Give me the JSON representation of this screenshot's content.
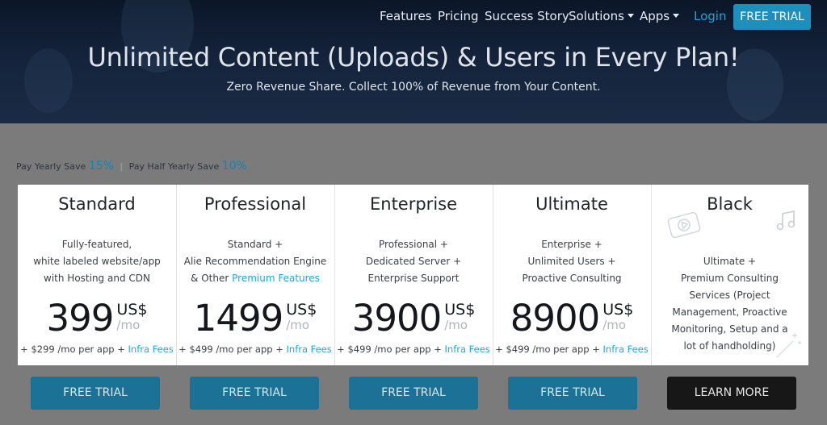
{
  "nav": {
    "items": [
      "Features",
      "Pricing",
      "Success Story",
      "Solutions",
      "Apps"
    ],
    "login": "Login",
    "free_trial": "FREE TRIAL"
  },
  "hero": {
    "title": "Unlimited Content (Uploads) & Users in Every Plan!",
    "subtitle": "Zero Revenue Share. Collect 100% of Revenue from Your Content."
  },
  "billing": {
    "yearly_label": "Pay Yearly Save",
    "yearly_pct": "15%",
    "half_label": "Pay Half Yearly Save",
    "half_pct": "10%"
  },
  "plans": [
    {
      "name": "Standard",
      "desc": [
        "Fully-featured,",
        "white labeled website/app",
        "with Hosting and CDN"
      ],
      "price": "399",
      "currency": "US$",
      "period": "/mo",
      "fee_text": "+ $299 /mo per app + ",
      "fee_link": "Infra Fees",
      "button": "FREE TRIAL"
    },
    {
      "name": "Professional",
      "desc": [
        "Standard +",
        "Alie Recommendation Engine",
        "& Other "
      ],
      "desc_link": "Premium Features",
      "price": "1499",
      "currency": "US$",
      "period": "/mo",
      "fee_text": "+ $499 /mo per app + ",
      "fee_link": "Infra Fees",
      "button": "FREE TRIAL"
    },
    {
      "name": "Enterprise",
      "desc": [
        "Professional +",
        "Dedicated Server +",
        "Enterprise Support"
      ],
      "price": "3900",
      "currency": "US$",
      "period": "/mo",
      "fee_text": "+ $499 /mo per app + ",
      "fee_link": "Infra Fees",
      "button": "FREE TRIAL"
    },
    {
      "name": "Ultimate",
      "desc": [
        "Enterprise +",
        "Unlimited Users +",
        "Proactive Consulting"
      ],
      "price": "8900",
      "currency": "US$",
      "period": "/mo",
      "fee_text": "+ $499 /mo per app + ",
      "fee_link": "Infra Fees",
      "button": "FREE TRIAL"
    },
    {
      "name": "Black",
      "desc": [
        "Ultimate +",
        "Premium Consulting",
        "Services (Project",
        "Management, Proactive",
        "Monitoring, Setup and a",
        "lot of handholding)"
      ],
      "button": "LEARN MORE"
    }
  ],
  "colors": {
    "accent": "#19a8e0",
    "primary_button": "#1b7296",
    "dark_button": "#171717",
    "hero_bg": "#14233b"
  },
  "icons": [
    "video-play-icon",
    "music-note-icon",
    "magic-wand-icon",
    "caret-down-icon"
  ]
}
